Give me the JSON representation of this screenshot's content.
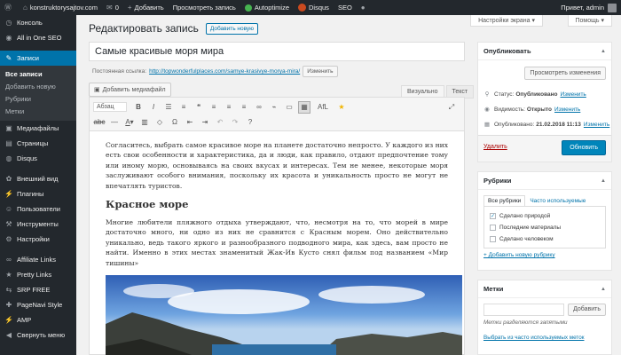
{
  "adminbar": {
    "site_name": "konstruktorysajtov.com",
    "comments_count": "0",
    "add_new": "Добавить",
    "view_post": "Просмотреть запись",
    "autoptimize": "Autoptimize",
    "disqus": "Disqus",
    "seo": "SEO",
    "greeting": "Привет, admin"
  },
  "sidebar": {
    "items": [
      {
        "label": "Консоль",
        "icon": "dashboard-icon"
      },
      {
        "label": "All in One SEO",
        "icon": "seo-icon"
      },
      {
        "label": "Записи",
        "icon": "pin-icon"
      },
      {
        "label": "Медиафайлы",
        "icon": "media-icon"
      },
      {
        "label": "Страницы",
        "icon": "pages-icon"
      },
      {
        "label": "Disqus",
        "icon": "comments-icon"
      },
      {
        "label": "Внешний вид",
        "icon": "appearance-icon"
      },
      {
        "label": "Плагины",
        "icon": "plugins-icon"
      },
      {
        "label": "Пользователи",
        "icon": "users-icon"
      },
      {
        "label": "Инструменты",
        "icon": "tools-icon"
      },
      {
        "label": "Настройки",
        "icon": "settings-icon"
      },
      {
        "label": "Affiliate Links",
        "icon": "link-icon"
      },
      {
        "label": "Pretty Links",
        "icon": "star-icon"
      },
      {
        "label": "SRP FREE",
        "icon": "srp-icon"
      },
      {
        "label": "PageNavi Style",
        "icon": "pagenavi-icon"
      },
      {
        "label": "AMP",
        "icon": "amp-icon"
      },
      {
        "label": "Свернуть меню",
        "icon": "collapse-icon"
      }
    ],
    "submenu": [
      "Все записи",
      "Добавить новую",
      "Рубрики",
      "Метки"
    ]
  },
  "screen_options": "Настройки экрана ▾",
  "help": "Помощь ▾",
  "page": {
    "title": "Редактировать запись",
    "add_new": "Добавить новую"
  },
  "post": {
    "title": "Самые красивые моря мира",
    "permalink_label": "Постоянная ссылка:",
    "permalink_url": "http://topwonderfulplaces.com/samye-krasivye-morya-mira/",
    "permalink_edit": "Изменить",
    "add_media": "Добавить медиафайл",
    "tab_visual": "Визуально",
    "tab_text": "Текст",
    "format_select": "Абзац",
    "paragraph1": "Согласитесь, выбрать самое красивое море на планете достаточно непросто. У каждого из них есть свои особенности и характеристика, да и люди, как правило, отдают предпочтение тому или иному морю, основываясь на своих вкусах и интересах. Тем не менее, некоторые моря заслуживают особого внимания, поскольку их красота и уникальность просто не могут не впечатлять туристов.",
    "heading": "Красное море",
    "paragraph2": "Многие любители пляжного отдыха утверждают, что, несмотря на то, что морей в мире достаточно много, ни одно из них не сравнится с Красным морем. Оно действительно уникально, ведь такого яркого и разнообразного подводного мира, как здесь, вам просто не найти. Именно в этих местах знаменитый Жак-Ив Кусто снял фильм под названием «Мир тишины»",
    "toolbar_afl": "AfL"
  },
  "publish": {
    "title": "Опубликовать",
    "preview": "Просмотреть изменения",
    "status_label": "Статус:",
    "status_value": "Опубликовано",
    "visibility_label": "Видимость:",
    "visibility_value": "Открыто",
    "published_label": "Опубликовано:",
    "published_value": "21.02.2018 11:13",
    "edit": "Изменить",
    "delete": "Удалить",
    "update": "Обновить"
  },
  "categories": {
    "title": "Рубрики",
    "tab_all": "Все рубрики",
    "tab_popular": "Часто используемые",
    "items": [
      {
        "label": "Сделано природой",
        "checked": true
      },
      {
        "label": "Последние материалы",
        "checked": false
      },
      {
        "label": "Сделано человеком",
        "checked": false
      }
    ],
    "add_new": "+ Добавить новую рубрику"
  },
  "tags": {
    "title": "Метки",
    "add": "Добавить",
    "hint": "Метки разделяются запятыми",
    "choose": "Выбрать из часто используемых меток"
  },
  "colors": {
    "adminbar_bg": "#23282d",
    "accent": "#0073aa",
    "primary_button": "#0085ba"
  }
}
